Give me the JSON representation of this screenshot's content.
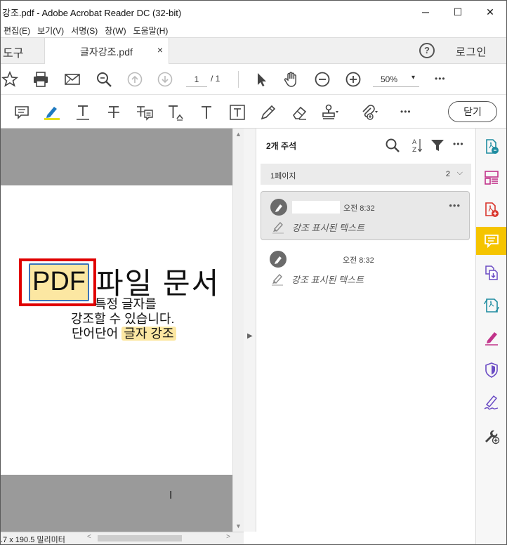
{
  "window": {
    "title": "강조.pdf - Adobe Acrobat Reader DC (32-bit)",
    "minimize": "─",
    "maximize": "☐",
    "close": "✕"
  },
  "menu": [
    "편집(E)",
    "보기(V)",
    "서명(S)",
    "창(W)",
    "도움말(H)"
  ],
  "tabs": {
    "tools": "도구",
    "file": "글자강조.pdf",
    "file_close": "×",
    "help": "?",
    "login": "로그인"
  },
  "toolbar": {
    "page_current": "1",
    "page_total": "/ 1",
    "zoom": "50%",
    "zoom_caret": "▾",
    "more": "•••"
  },
  "toolbar2": {
    "close_label": "닫기",
    "more": "•••"
  },
  "document": {
    "highlight_word": "PDF",
    "heading_rest": "파일 문서",
    "line2": "특정 글자를",
    "line3": "강조할 수 있습니다.",
    "line4_plain": "단어단어",
    "line4_highlight": "글자 강조",
    "cursor": "I"
  },
  "status": {
    "dimensions": ".7 x 190.5 밀리미터",
    "scroll_left": "<",
    "scroll_right": ">",
    "scroll_up": "▲",
    "scroll_down": "▼",
    "collapse": "▶"
  },
  "comments_panel": {
    "title": "2개 주석",
    "page_group_label": "1페이지",
    "page_group_count": "2",
    "page_group_chevron": "⌵",
    "comments": [
      {
        "time": "오전 8:32",
        "text": "강조 표시된 텍스트",
        "more": "•••"
      },
      {
        "time": "오전 8:32",
        "text": "강조 표시된 텍스트"
      }
    ]
  },
  "colors": {
    "highlight": "#fce7a2",
    "selection_border": "#e00000",
    "rail_active": "#f5c400",
    "rail_teal": "#1e8ca0",
    "rail_red": "#d9342b",
    "rail_magenta": "#c1338a",
    "rail_purple": "#6a4bc4"
  },
  "icons": {
    "rail": [
      "export-pdf-icon",
      "organize-pages-icon",
      "create-pdf-icon",
      "comment-icon",
      "combine-files-icon",
      "send-for-review-icon",
      "fill-sign-icon",
      "protect-icon",
      "request-signature-icon",
      "more-tools-icon"
    ]
  }
}
